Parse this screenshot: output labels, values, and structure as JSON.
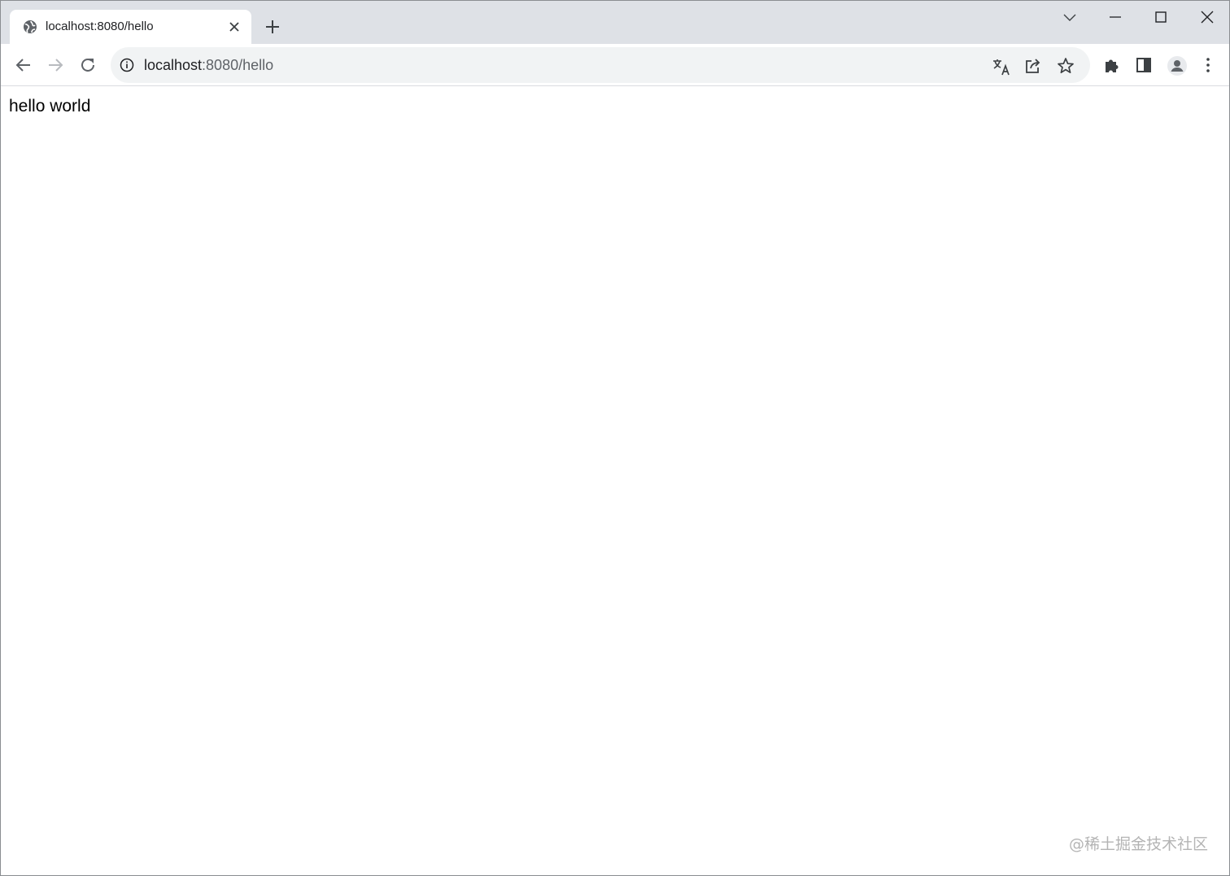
{
  "tab": {
    "title": "localhost:8080/hello",
    "favicon": "globe-icon"
  },
  "address_bar": {
    "host": "localhost",
    "rest": ":8080/hello"
  },
  "page": {
    "body_text": "hello world"
  },
  "watermark": "@稀土掘金技术社区",
  "colors": {
    "tabstrip_bg": "#dee1e6",
    "omnibox_bg": "#f1f3f4",
    "icon": "#5f6368"
  }
}
